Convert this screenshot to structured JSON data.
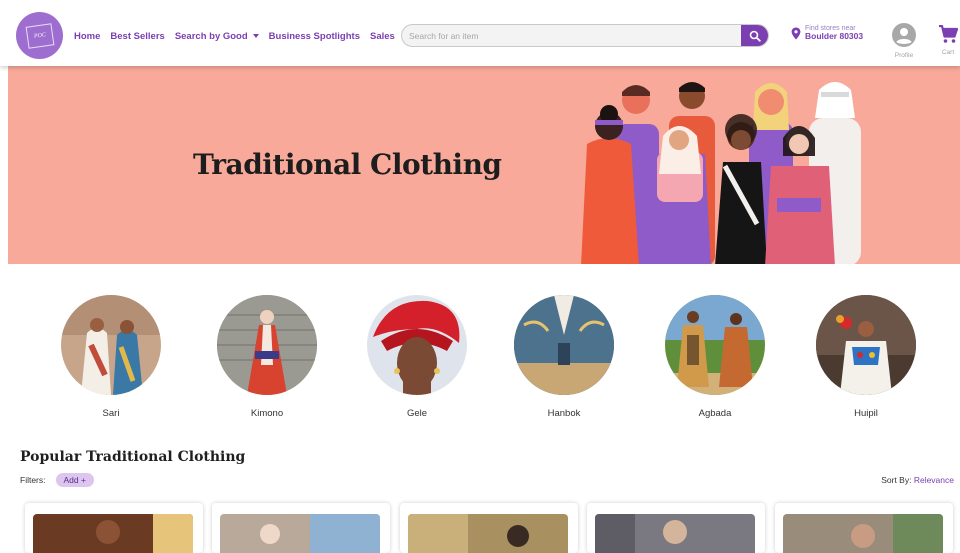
{
  "header": {
    "logo_text": "POC",
    "nav": {
      "home": "Home",
      "best_sellers": "Best Sellers",
      "search_by_good": "Search by Good",
      "business_spotlights": "Business Spotlights",
      "sales": "Sales"
    },
    "search": {
      "placeholder": "Search for an item",
      "value": ""
    },
    "store": {
      "label": "Find stores near",
      "location": "Boulder 80303"
    },
    "profile_label": "Profile",
    "cart_label": "Cart"
  },
  "hero": {
    "title": "Traditional Clothing"
  },
  "categories": [
    {
      "label": "Sari"
    },
    {
      "label": "Kimono"
    },
    {
      "label": "Gele"
    },
    {
      "label": "Hanbok"
    },
    {
      "label": "Agbada"
    },
    {
      "label": "Huipil"
    }
  ],
  "popular": {
    "title": "Popular Traditional Clothing",
    "filters_label": "Filters:",
    "add_label": "Add +",
    "sort_label": "Sort By:",
    "sort_value": "Relevance"
  },
  "colors": {
    "accent": "#7b3fb1",
    "hero_bg": "#f9a999",
    "chip_bg": "#dcc6ef"
  }
}
